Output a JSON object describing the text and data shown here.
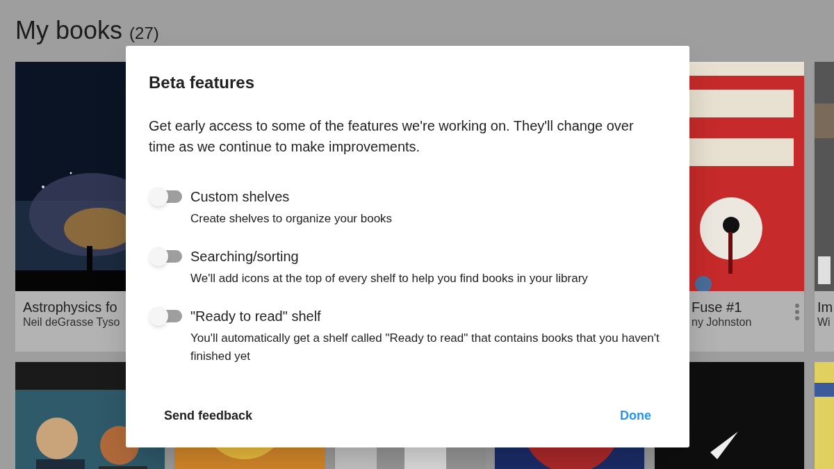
{
  "page": {
    "title": "My books",
    "count": "(27)"
  },
  "books": [
    {
      "title": "Astrophysics fo",
      "author": "Neil deGrasse Tyso"
    },
    {
      "title": "Fuse #1",
      "author": "ny Johnston",
      "has_menu": true
    },
    {
      "title": "Im",
      "author": "Wi"
    }
  ],
  "dialog": {
    "title": "Beta features",
    "intro": "Get early access to some of the features we're working on. They'll change over time as we continue to make improvements.",
    "features": [
      {
        "label": "Custom shelves",
        "description": "Create shelves to organize your books",
        "on": false
      },
      {
        "label": "Searching/sorting",
        "description": "We'll add icons at the top of every shelf to help you find books in your library",
        "on": false
      },
      {
        "label": "\"Ready to read\" shelf",
        "description": "You'll automatically get a shelf called \"Ready to read\" that contains books that you haven't finished yet",
        "on": false
      }
    ],
    "buttons": [
      "Send feedback",
      "Done"
    ]
  }
}
